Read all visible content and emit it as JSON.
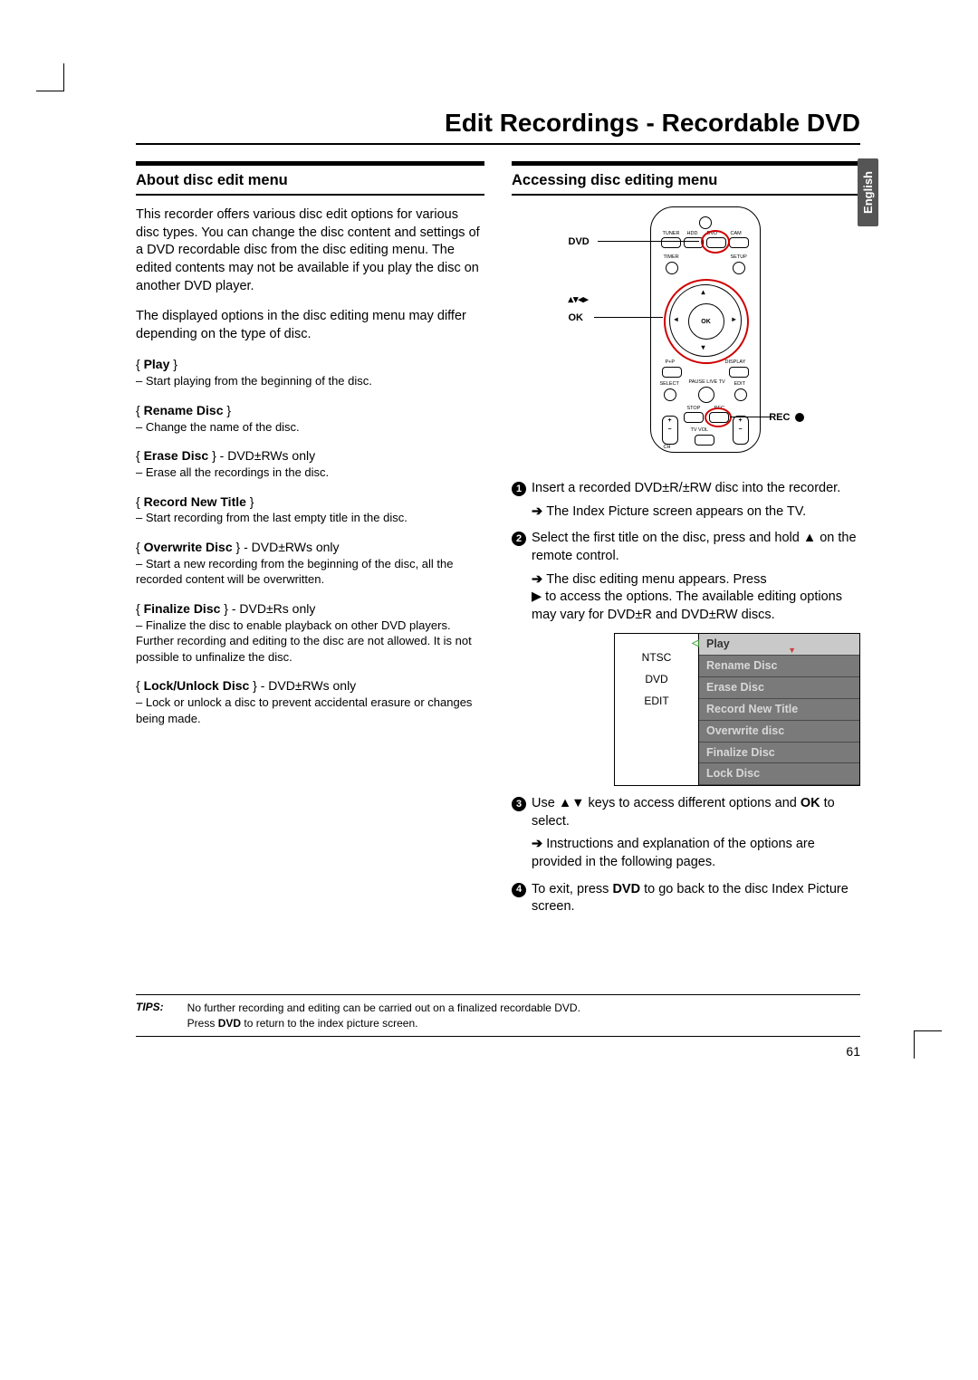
{
  "page_title": "Edit Recordings - Recordable DVD",
  "language_tab": "English",
  "page_number": "61",
  "left": {
    "heading": "About disc edit menu",
    "intro1": "This recorder offers various disc edit options for various disc types. You can change the disc content and settings of a DVD recordable disc from the disc editing menu. The edited contents may not be available if you play the disc on another DVD player.",
    "intro2": "The displayed options in the disc editing menu may differ depending on the type of disc.",
    "options": [
      {
        "title": "Play",
        "suffix": "",
        "desc": "–  Start playing from the beginning of the disc."
      },
      {
        "title": "Rename Disc",
        "suffix": "",
        "desc": "–  Change the name of the disc."
      },
      {
        "title": "Erase Disc",
        "suffix": " - DVD±RWs only",
        "desc": "–  Erase all the recordings in the disc."
      },
      {
        "title": "Record New Title",
        "suffix": "",
        "desc": "–  Start recording from the last empty title in the disc."
      },
      {
        "title": "Overwrite Disc",
        "suffix": " - DVD±RWs only",
        "desc": "–  Start a new recording from the beginning of the disc, all the recorded content will be overwritten."
      },
      {
        "title": "Finalize Disc",
        "suffix": " - DVD±Rs only",
        "desc": "–  Finalize the disc to enable playback on other DVD players. Further recording and editing to the disc are not allowed. It is not possible to unfinalize the disc."
      },
      {
        "title": "Lock/Unlock Disc",
        "suffix": " - DVD±RWs only",
        "desc": "–  Lock or unlock a disc to prevent accidental erasure or changes being made."
      }
    ]
  },
  "right": {
    "heading": "Accessing disc editing menu",
    "remote": {
      "label_dvd": "DVD",
      "label_arrows": "▴▾◂▸",
      "label_ok": "OK",
      "label_rec": "REC",
      "btn_tuner": "TUNER",
      "btn_hdd": "HDD",
      "btn_dvd": "DVD",
      "btn_cam": "CAM",
      "btn_timer": "TIMER",
      "btn_setup": "SETUP",
      "btn_pp": "P+P",
      "btn_display": "DISPLAY",
      "btn_select": "SELECT",
      "btn_pause": "PAUSE LIVE TV",
      "btn_edit": "EDIT",
      "btn_stop": "STOP",
      "btn_rec": "REC",
      "btn_ch": "CH",
      "btn_tvvol": "TV VOL"
    },
    "steps": {
      "s1": "Insert a recorded DVD±R/±RW disc into the recorder.",
      "r1": "The Index Picture screen appears on the TV.",
      "s2a": "Select the first title on the disc, press and hold ",
      "s2b": " on the remote control.",
      "r2a": "The disc editing menu appears. Press ",
      "r2b": " to access the options. The available editing options may vary for DVD±R and DVD±RW discs.",
      "s3a": "Use ",
      "s3b": " keys to access different options and ",
      "s3c": " to select.",
      "s3_ok": "OK",
      "r3": "Instructions and explanation of the options are provided in the following pages.",
      "s4a": "To exit, press ",
      "s4b": " to go back to the disc Index Picture screen.",
      "s4_dvd": "DVD"
    },
    "menu": {
      "left": [
        "NTSC",
        "DVD",
        "EDIT"
      ],
      "items": [
        "Play",
        "Rename Disc",
        "Erase Disc",
        "Record New Title",
        "Overwrite disc",
        "Finalize Disc",
        "Lock Disc"
      ]
    }
  },
  "tips": {
    "label": "TIPS:",
    "body_l1": "No further recording and editing can be carried out on a finalized recordable DVD.",
    "body_l2": "Press DVD to return to the index picture screen."
  },
  "glyphs": {
    "up": "▲",
    "down": "▼",
    "left": "◀",
    "right": "▶",
    "updown": "▲▼"
  }
}
